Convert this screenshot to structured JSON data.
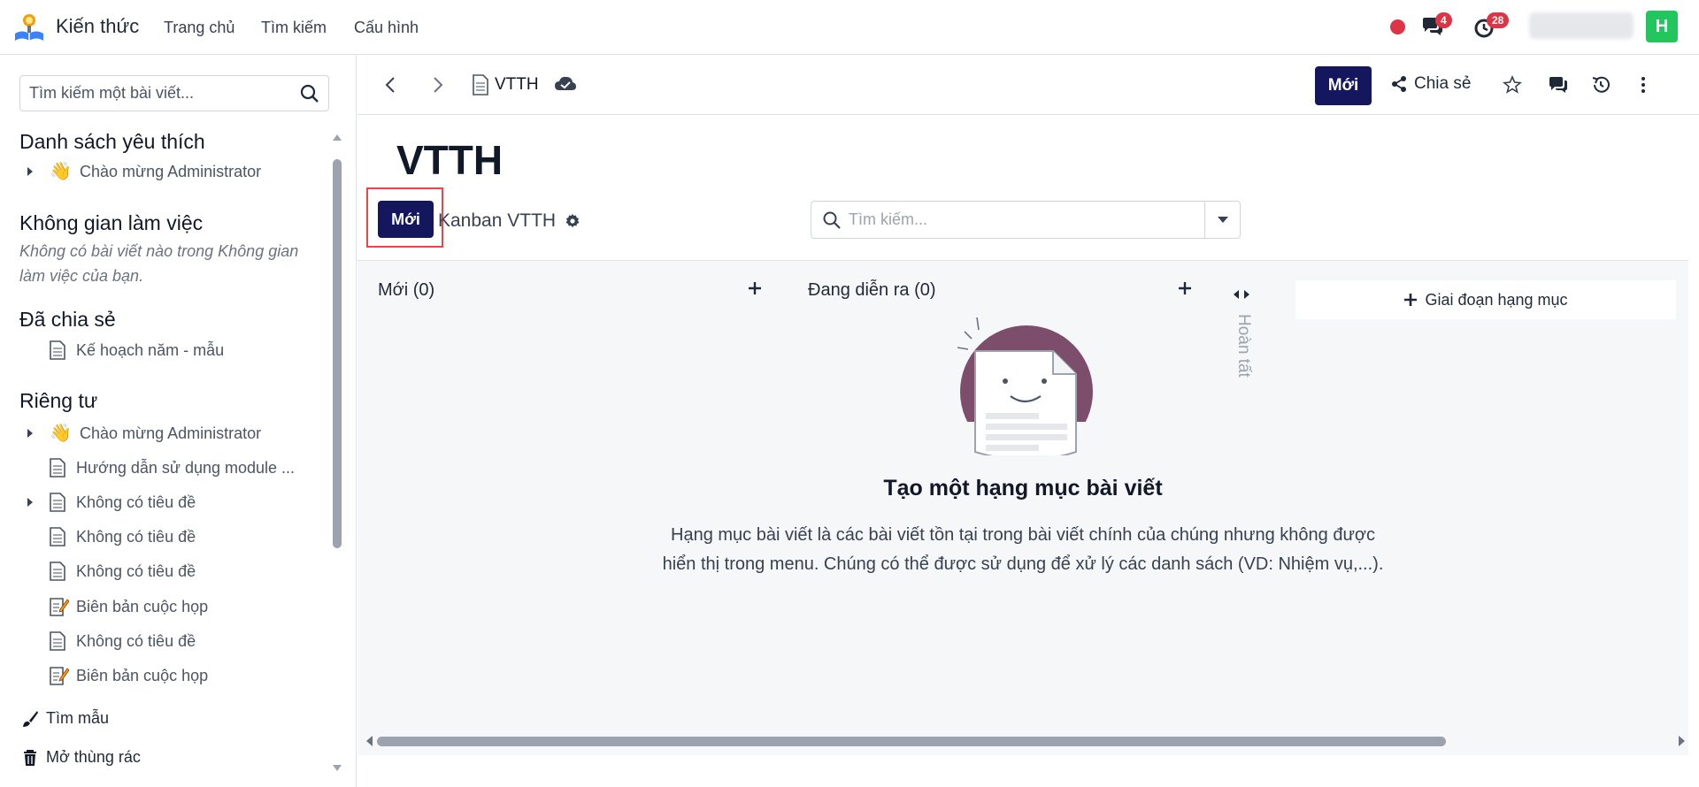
{
  "navbar": {
    "app_name": "Kiến thức",
    "links": [
      "Trang chủ",
      "Tìm kiếm",
      "Cấu hình"
    ],
    "chat_badge": "4",
    "activity_badge": "28",
    "avatar_initial": "H",
    "avatar_color": "#22c55e"
  },
  "sidebar": {
    "search_placeholder": "Tìm kiếm một bài viết...",
    "favorites": {
      "title": "Danh sách yêu thích",
      "items": [
        {
          "label": "Chào mừng Administrator",
          "icon": "waving-hand-icon",
          "expandable": true
        }
      ]
    },
    "workspace": {
      "title": "Không gian làm việc",
      "note": "Không có bài viết nào trong Không gian làm việc của bạn."
    },
    "shared": {
      "title": "Đã chia sẻ",
      "items": [
        {
          "label": "Kế hoạch năm - mẫu",
          "icon": "document-icon",
          "expandable": false
        }
      ]
    },
    "private": {
      "title": "Riêng tư",
      "items": [
        {
          "label": "Chào mừng Administrator",
          "icon": "waving-hand-icon",
          "expandable": true
        },
        {
          "label": "Hướng dẫn sử dụng module ...",
          "icon": "document-icon",
          "expandable": false
        },
        {
          "label": "Không có tiêu đề",
          "icon": "document-icon",
          "expandable": true
        },
        {
          "label": "Không có tiêu đề",
          "icon": "document-icon",
          "expandable": false
        },
        {
          "label": "Không có tiêu đề",
          "icon": "document-icon",
          "expandable": false
        },
        {
          "label": "Biên bản cuộc họp",
          "icon": "memo-icon",
          "expandable": false
        },
        {
          "label": "Không có tiêu đề",
          "icon": "document-icon",
          "expandable": false
        },
        {
          "label": "Biên bản cuộc họp",
          "icon": "memo-icon",
          "expandable": false
        }
      ]
    },
    "footer": {
      "templates": "Tìm mẫu",
      "trash": "Mở thùng rác"
    }
  },
  "control_bar": {
    "breadcrumb_title": "VTTH",
    "new_label": "Mới",
    "share_label": "Chia sẻ"
  },
  "article": {
    "title": "VTTH",
    "kanban": {
      "new_label": "Mới",
      "name": "Kanban VTTH",
      "search_placeholder": "Tìm kiếm...",
      "columns": [
        {
          "title": "Mới (0)"
        },
        {
          "title": "Đang diễn ra (0)"
        }
      ],
      "folded_column": "Hoàn tất",
      "add_stage_label": "Giai đoạn hạng mục",
      "helper_title": "Tạo một hạng mục bài viết",
      "helper_text": "Hạng mục bài viết là các bài viết tồn tại trong bài viết chính của chúng nhưng không được hiển thị trong menu. Chúng có thể được sử dụng để xử lý các danh sách (VD: Nhiệm vụ,...)."
    }
  },
  "colors": {
    "primary": "#14175e",
    "badge": "#dc3545",
    "highlight": "#ef4444"
  }
}
